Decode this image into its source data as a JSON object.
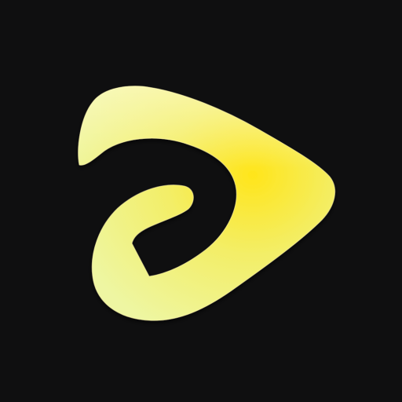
{
  "app_icon": {
    "icon_name": "play-swirl-logo-icon",
    "colors": {
      "background": "#0f0f10",
      "glyph_light": "#f1f7a4",
      "glyph_mid": "#f3ee67",
      "glyph_bright": "#ffe51b",
      "glyph_edge": "#fff6b0"
    }
  }
}
